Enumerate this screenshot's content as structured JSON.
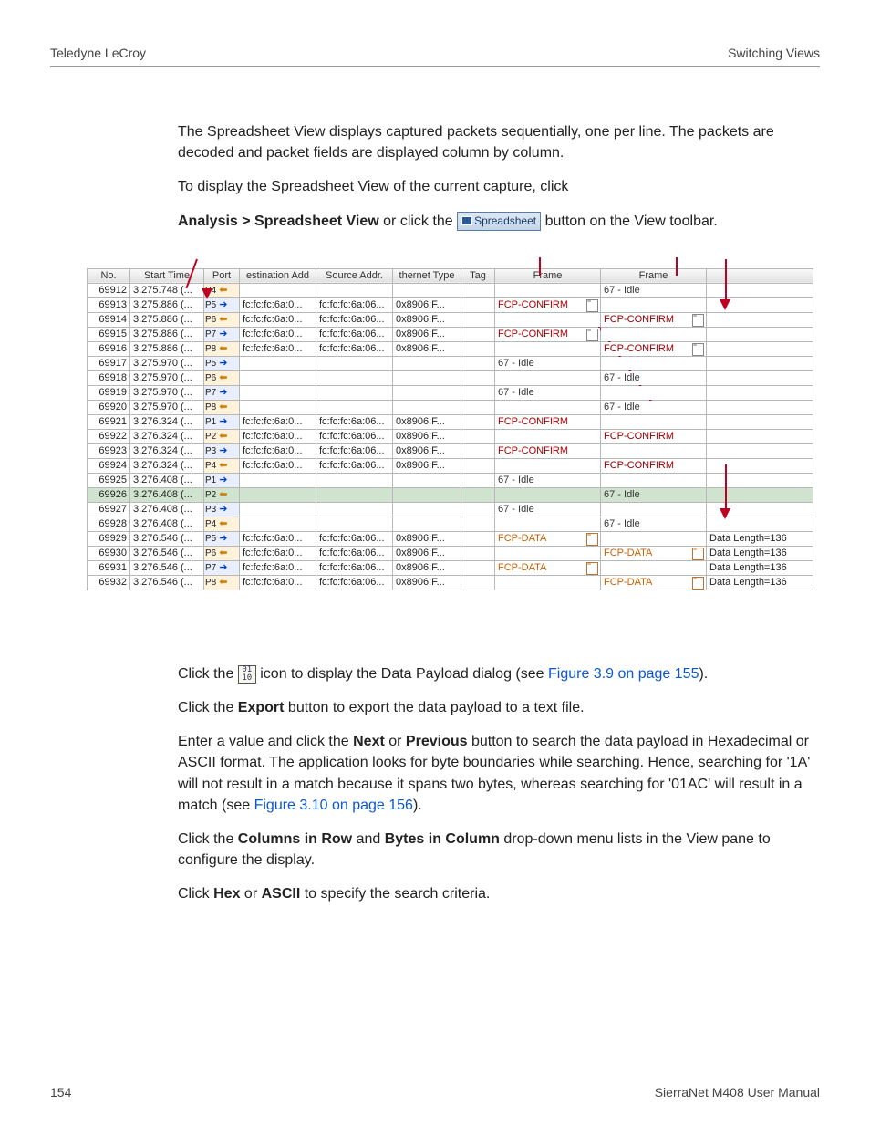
{
  "header": {
    "left": "Teledyne LeCroy",
    "right": "Switching Views"
  },
  "para1": "The Spreadsheet View displays captured packets sequentially, one per line. The packets are decoded and packet fields are displayed column by column.",
  "para2": "To display the Spreadsheet View of the current capture, click",
  "para3a": "Analysis > Spreadsheet View",
  "para3b": " or click the ",
  "spreadsheet_btn": "Spreadsheet",
  "para3c": " button on the  View toolbar.",
  "table": {
    "headers": [
      "No.",
      "Start Time",
      "Port",
      "estination Add",
      "Source Addr.",
      "thernet Type",
      "Tag",
      "Frame",
      "Frame",
      ""
    ],
    "rows": [
      {
        "no": "69912",
        "time": "3.275.748 (...",
        "port": "P4",
        "dir": "in",
        "dst": "",
        "src": "",
        "eth": "",
        "tag": "",
        "f1": "",
        "f2": "67 - Idle",
        "f2c": "idle",
        "ext": ""
      },
      {
        "no": "69913",
        "time": "3.275.886 (...",
        "port": "P5",
        "dir": "out",
        "dst": "fc:fc:fc:6a:0...",
        "src": "fc:fc:fc:6a:06...",
        "eth": "0x8906:F...",
        "tag": "",
        "f1": "FCP-CONFIRM",
        "f1c": "fcp-confirm",
        "f1i": true,
        "f2": "",
        "ext": ""
      },
      {
        "no": "69914",
        "time": "3.275.886 (...",
        "port": "P6",
        "dir": "in",
        "dst": "fc:fc:fc:6a:0...",
        "src": "fc:fc:fc:6a:06...",
        "eth": "0x8906:F...",
        "tag": "",
        "f1": "",
        "f2": "FCP-CONFIRM",
        "f2c": "fcp-confirm-g",
        "f2i": true,
        "ext": ""
      },
      {
        "no": "69915",
        "time": "3.275.886 (...",
        "port": "P7",
        "dir": "out",
        "dst": "fc:fc:fc:6a:0...",
        "src": "fc:fc:fc:6a:06...",
        "eth": "0x8906:F...",
        "tag": "",
        "f1": "FCP-CONFIRM",
        "f1c": "fcp-confirm",
        "f1i": true,
        "f2": "",
        "ext": ""
      },
      {
        "no": "69916",
        "time": "3.275.886 (...",
        "port": "P8",
        "dir": "in",
        "dst": "fc:fc:fc:6a:0...",
        "src": "fc:fc:fc:6a:06...",
        "eth": "0x8906:F...",
        "tag": "",
        "f1": "",
        "f2": "FCP-CONFIRM",
        "f2c": "fcp-confirm-g",
        "f2i": true,
        "ext": ""
      },
      {
        "no": "69917",
        "time": "3.275.970 (...",
        "port": "P5",
        "dir": "out",
        "dst": "",
        "src": "",
        "eth": "",
        "tag": "",
        "f1": "67 - Idle",
        "f1c": "idle",
        "f2": "",
        "ext": ""
      },
      {
        "no": "69918",
        "time": "3.275.970 (...",
        "port": "P6",
        "dir": "in",
        "dst": "",
        "src": "",
        "eth": "",
        "tag": "",
        "f1": "",
        "f2": "67 - Idle",
        "f2c": "idle",
        "ext": ""
      },
      {
        "no": "69919",
        "time": "3.275.970 (...",
        "port": "P7",
        "dir": "out",
        "dst": "",
        "src": "",
        "eth": "",
        "tag": "",
        "f1": "67 - Idle",
        "f1c": "idle",
        "f2": "",
        "ext": ""
      },
      {
        "no": "69920",
        "time": "3.275.970 (...",
        "port": "P8",
        "dir": "in",
        "dst": "",
        "src": "",
        "eth": "",
        "tag": "",
        "f1": "",
        "f2": "67 - Idle",
        "f2c": "idle",
        "ext": ""
      },
      {
        "no": "69921",
        "time": "3.276.324 (...",
        "port": "P1",
        "dir": "out",
        "dst": "fc:fc:fc:6a:0...",
        "src": "fc:fc:fc:6a:06...",
        "eth": "0x8906:F...",
        "tag": "",
        "f1": "FCP-CONFIRM",
        "f1c": "fcp-confirm",
        "f2": "",
        "ext": ""
      },
      {
        "no": "69922",
        "time": "3.276.324 (...",
        "port": "P2",
        "dir": "in",
        "dst": "fc:fc:fc:6a:0...",
        "src": "fc:fc:fc:6a:06...",
        "eth": "0x8906:F...",
        "tag": "",
        "f1": "",
        "f2": "FCP-CONFIRM",
        "f2c": "fcp-confirm-g",
        "ext": ""
      },
      {
        "no": "69923",
        "time": "3.276.324 (...",
        "port": "P3",
        "dir": "out",
        "dst": "fc:fc:fc:6a:0...",
        "src": "fc:fc:fc:6a:06...",
        "eth": "0x8906:F...",
        "tag": "",
        "f1": "FCP-CONFIRM",
        "f1c": "fcp-confirm",
        "f2": "",
        "ext": ""
      },
      {
        "no": "69924",
        "time": "3.276.324 (...",
        "port": "P4",
        "dir": "in",
        "dst": "fc:fc:fc:6a:0...",
        "src": "fc:fc:fc:6a:06...",
        "eth": "0x8906:F...",
        "tag": "",
        "f1": "",
        "f2": "FCP-CONFIRM",
        "f2c": "fcp-confirm-g",
        "ext": ""
      },
      {
        "no": "69925",
        "time": "3.276.408 (...",
        "port": "P1",
        "dir": "out",
        "dst": "",
        "src": "",
        "eth": "",
        "tag": "",
        "f1": "67 - Idle",
        "f1c": "idle",
        "f2": "",
        "ext": ""
      },
      {
        "no": "69926",
        "time": "3.276.408 (...",
        "port": "P2",
        "dir": "in",
        "dst": "",
        "src": "",
        "eth": "",
        "tag": "",
        "f1": "",
        "f2": "67 - Idle",
        "f2c": "idle",
        "ext": "",
        "sel": true,
        "dot": true
      },
      {
        "no": "69927",
        "time": "3.276.408 (...",
        "port": "P3",
        "dir": "out",
        "dst": "",
        "src": "",
        "eth": "",
        "tag": "",
        "f1": "67 - Idle",
        "f1c": "idle",
        "f2": "",
        "ext": ""
      },
      {
        "no": "69928",
        "time": "3.276.408 (...",
        "port": "P4",
        "dir": "in",
        "dst": "",
        "src": "",
        "eth": "",
        "tag": "",
        "f1": "",
        "f2": "67 - Idle",
        "f2c": "idle",
        "ext": ""
      },
      {
        "no": "69929",
        "time": "3.276.546 (...",
        "port": "P5",
        "dir": "out",
        "dst": "fc:fc:fc:6a:0...",
        "src": "fc:fc:fc:6a:06...",
        "eth": "0x8906:F...",
        "tag": "",
        "f1": "FCP-DATA",
        "f1c": "fcp-data",
        "f1io": true,
        "f2": "",
        "ext": "Data Length=136"
      },
      {
        "no": "69930",
        "time": "3.276.546 (...",
        "port": "P6",
        "dir": "in",
        "dst": "fc:fc:fc:6a:0...",
        "src": "fc:fc:fc:6a:06...",
        "eth": "0x8906:F...",
        "tag": "",
        "f1": "",
        "f2": "FCP-DATA",
        "f2c": "fcp-data",
        "f2io": true,
        "ext": "Data Length=136"
      },
      {
        "no": "69931",
        "time": "3.276.546 (...",
        "port": "P7",
        "dir": "out",
        "dst": "fc:fc:fc:6a:0...",
        "src": "fc:fc:fc:6a:06...",
        "eth": "0x8906:F...",
        "tag": "",
        "f1": "FCP-DATA",
        "f1c": "fcp-data",
        "f1io": true,
        "f2": "",
        "ext": "Data Length=136"
      },
      {
        "no": "69932",
        "time": "3.276.546 (...",
        "port": "P8",
        "dir": "in",
        "dst": "fc:fc:fc:6a:0...",
        "src": "fc:fc:fc:6a:06...",
        "eth": "0x8906:F...",
        "tag": "",
        "f1": "",
        "f2": "FCP-DATA",
        "f2c": "fcp-data",
        "f2io": true,
        "ext": "Data Length=136"
      }
    ]
  },
  "para4a": "Click the ",
  "payload_icon": "01\n10",
  "para4b": " icon to display the Data Payload dialog (see ",
  "link1": "Figure 3.9 on page 155",
  "para4c": ").",
  "para5a": "Click the ",
  "para5b": "Export",
  "para5c": " button to export the data payload to a text file.",
  "para6a": "Enter a value and click the ",
  "para6b": "Next",
  "para6c": " or ",
  "para6d": "Previous",
  "para6e": " button to search the data payload in Hexadecimal or ASCII format. The application looks for byte boundaries while searching. Hence, searching for '1A' will not result in a match because it spans two bytes, whereas searching for '01AC' will result in a match (see ",
  "link2": "Figure 3.10 on page 156",
  "para6f": ").",
  "para7a": "Click the ",
  "para7b": "Columns in Row",
  "para7c": " and ",
  "para7d": "Bytes in Column",
  "para7e": " drop-down menu lists in the View pane to configure the display.",
  "para8a": "Click ",
  "para8b": "Hex",
  "para8c": " or ",
  "para8d": "ASCII",
  "para8e": " to specify the search criteria.",
  "footer": {
    "left": "154",
    "right": "SierraNet M408 User Manual"
  }
}
